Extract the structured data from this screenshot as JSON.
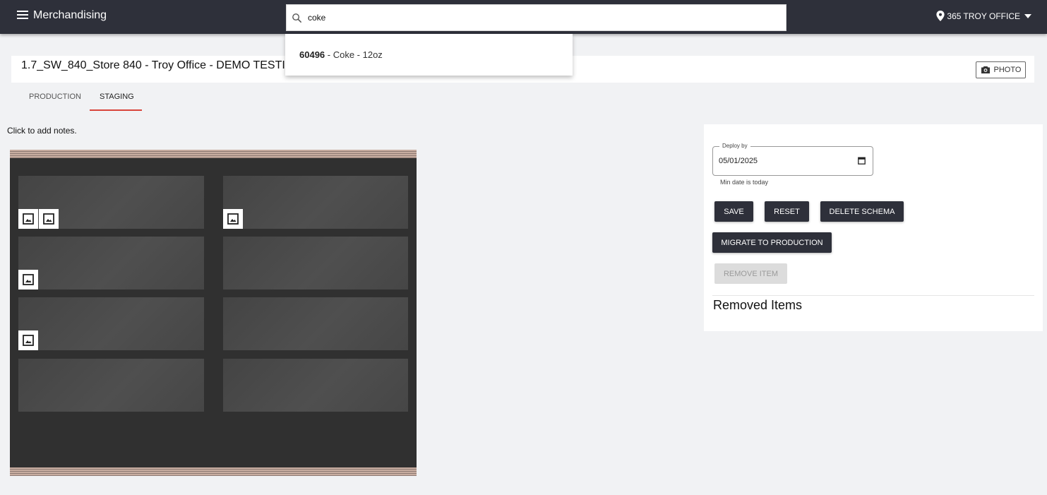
{
  "header": {
    "app_title": "Merchandising",
    "location": "365 TROY OFFICE",
    "icons": [
      "menu-icon",
      "search-icon",
      "pin-icon",
      "caret-down-icon"
    ]
  },
  "search": {
    "value": "coke",
    "results": [
      {
        "code": "60496",
        "name": " - Coke - 12oz"
      }
    ]
  },
  "schema": {
    "title": "1.7_SW_840_Store 840 - Troy Office - DEMO TESTIN",
    "photo_button": "PHOTO"
  },
  "tabs": [
    {
      "label": "PRODUCTION",
      "active": false
    },
    {
      "label": "STAGING",
      "active": true
    }
  ],
  "notes_placeholder": "Click to add notes.",
  "cooler": {
    "shelf_rows": 4,
    "shelf_columns": 2,
    "colors": {
      "body": "#303030",
      "shelf": "#4a4a4a",
      "trim": "#c8ada0"
    },
    "items": [
      {
        "row": 1,
        "column": 1,
        "count": 2
      },
      {
        "row": 1,
        "column": 2,
        "count": 1
      },
      {
        "row": 2,
        "column": 1,
        "count": 1
      },
      {
        "row": 3,
        "column": 1,
        "count": 1
      }
    ]
  },
  "panel": {
    "deploy_label": "Deploy by",
    "deploy_date": "05/01/2025",
    "helper_text": "Min date is today",
    "buttons": {
      "save": "SAVE",
      "reset": "RESET",
      "delete": "DELETE SCHEMA",
      "migrate": "MIGRATE TO PRODUCTION",
      "remove": "REMOVE ITEM"
    },
    "removed_heading": "Removed Items"
  },
  "colors": {
    "topbar": "#2e303a",
    "tab_underline": "#d9453a",
    "page_background": "#f1f2f4",
    "disabled_button": "#dcdcdc"
  }
}
